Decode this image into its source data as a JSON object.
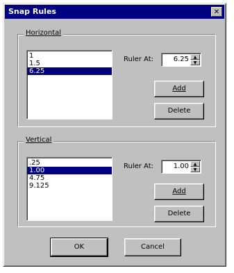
{
  "window": {
    "title": "Snap Rules"
  },
  "icons": {
    "close": "close-icon",
    "spin_up": "up-arrow-icon",
    "spin_down": "down-arrow-icon"
  },
  "horizontal": {
    "legend": "Horizontal",
    "items": [
      {
        "label": "1",
        "selected": false
      },
      {
        "label": "1.5",
        "selected": false
      },
      {
        "label": "6.25",
        "selected": true
      }
    ],
    "ruler_label": "Ruler At:",
    "ruler_value": "6.25",
    "add_label": "Add",
    "delete_label": "Delete"
  },
  "vertical": {
    "legend": "Vertical",
    "items": [
      {
        "label": ".25",
        "selected": false
      },
      {
        "label": "1.00",
        "selected": true
      },
      {
        "label": "4.75",
        "selected": false
      },
      {
        "label": "9.125",
        "selected": false
      }
    ],
    "ruler_label": "Ruler At:",
    "ruler_value": "1.00",
    "add_label": "Add",
    "delete_label": "Delete"
  },
  "footer": {
    "ok_label": "OK",
    "cancel_label": "Cancel"
  }
}
